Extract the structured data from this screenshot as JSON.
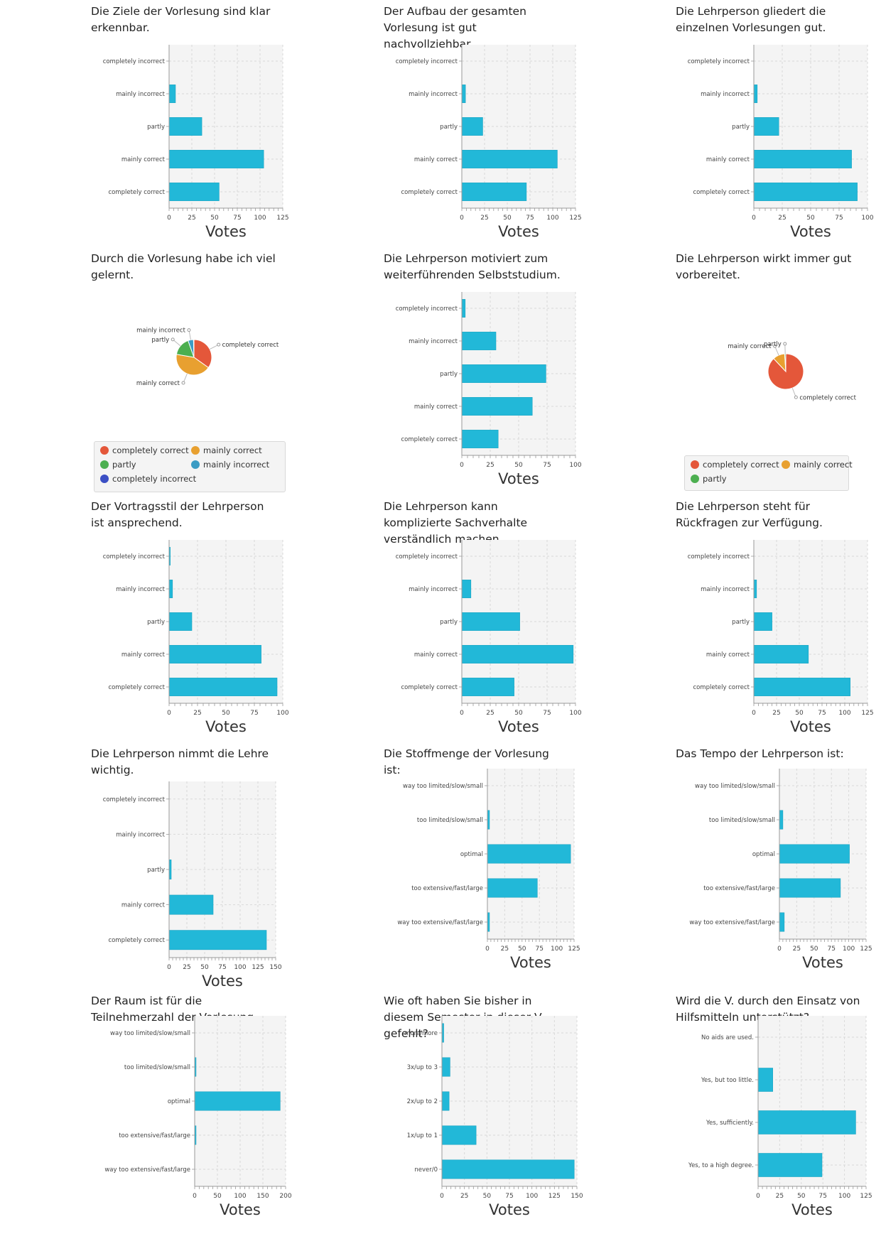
{
  "colors": {
    "bar": "#22b8d8",
    "plot_bg": "#f4f4f4",
    "completely_correct": "#e4573a",
    "mainly_correct": "#e8a030",
    "partly": "#4caf50",
    "mainly_incorrect": "#3b9cc4",
    "completely_incorrect": "#3b4fc4"
  },
  "chart_data": [
    {
      "type": "bar",
      "title": "Die Ziele der Vorlesung sind klar erkennbar.",
      "xlabel": "Votes",
      "categories": [
        "completely incorrect",
        "mainly incorrect",
        "partly",
        "mainly correct",
        "completely correct"
      ],
      "values": [
        0,
        7,
        36,
        104,
        55
      ],
      "xlim": [
        0,
        125
      ],
      "xticks": [
        "0",
        "25",
        "50",
        "75",
        "100",
        "125"
      ]
    },
    {
      "type": "bar",
      "title": "Der Aufbau der gesamten Vorlesung ist gut nachvollziehbar.",
      "xlabel": "Votes",
      "categories": [
        "completely incorrect",
        "mainly incorrect",
        "partly",
        "mainly correct",
        "completely correct"
      ],
      "values": [
        0,
        4,
        23,
        105,
        71
      ],
      "xlim": [
        0,
        125
      ],
      "xticks": [
        "0",
        "25",
        "50",
        "75",
        "100",
        "125"
      ]
    },
    {
      "type": "bar",
      "title": "Die Lehrperson gliedert die einzelnen Vorlesungen gut.",
      "xlabel": "Votes",
      "categories": [
        "completely incorrect",
        "mainly incorrect",
        "partly",
        "mainly correct",
        "completely correct"
      ],
      "values": [
        0,
        3,
        22,
        86,
        91
      ],
      "xlim": [
        0,
        100
      ],
      "xticks": [
        "0",
        "25",
        "50",
        "75",
        "100"
      ]
    },
    {
      "type": "pie",
      "title": "Durch die Vorlesung habe ich viel gelernt.",
      "slices": [
        {
          "label": "completely correct",
          "value": 35,
          "color": "#e4573a"
        },
        {
          "label": "mainly correct",
          "value": 43,
          "color": "#e8a030"
        },
        {
          "label": "partly",
          "value": 17,
          "color": "#4caf50"
        },
        {
          "label": "mainly incorrect",
          "value": 5,
          "color": "#3b9cc4"
        },
        {
          "label": "completely incorrect",
          "value": 0.4,
          "color": "#3b4fc4"
        }
      ],
      "legend": [
        "completely correct",
        "mainly correct",
        "partly",
        "mainly incorrect",
        "completely incorrect"
      ]
    },
    {
      "type": "bar",
      "title": "Die Lehrperson motiviert zum weiterführenden Selbststudium.",
      "xlabel": "Votes",
      "categories": [
        "completely incorrect",
        "mainly incorrect",
        "partly",
        "mainly correct",
        "completely correct"
      ],
      "values": [
        3,
        30,
        74,
        62,
        32
      ],
      "xlim": [
        0,
        100
      ],
      "xticks": [
        "0",
        "25",
        "50",
        "75",
        "100"
      ]
    },
    {
      "type": "pie",
      "title": "Die Lehrperson wirkt immer gut vorbereitet.",
      "slices": [
        {
          "label": "completely correct",
          "value": 88,
          "color": "#e4573a"
        },
        {
          "label": "mainly correct",
          "value": 11,
          "color": "#e8a030"
        },
        {
          "label": "partly",
          "value": 1,
          "color": "#4caf50"
        }
      ],
      "legend": [
        "completely correct",
        "mainly correct",
        "partly"
      ]
    },
    {
      "type": "bar",
      "title": "Der Vortragsstil der Lehrperson ist ansprechend.",
      "xlabel": "Votes",
      "categories": [
        "completely incorrect",
        "mainly incorrect",
        "partly",
        "mainly correct",
        "completely correct"
      ],
      "values": [
        1,
        3,
        20,
        81,
        95
      ],
      "xlim": [
        0,
        100
      ],
      "xticks": [
        "0",
        "25",
        "50",
        "75",
        "100"
      ]
    },
    {
      "type": "bar",
      "title": "Die Lehrperson kann komplizierte Sachverhalte verständlich machen.",
      "xlabel": "Votes",
      "categories": [
        "completely incorrect",
        "mainly incorrect",
        "partly",
        "mainly correct",
        "completely correct"
      ],
      "values": [
        0,
        8,
        51,
        98,
        46
      ],
      "xlim": [
        0,
        100
      ],
      "xticks": [
        "0",
        "25",
        "50",
        "75",
        "100"
      ]
    },
    {
      "type": "bar",
      "title": "Die Lehrperson steht für Rückfragen zur Verfügung.",
      "xlabel": "Votes",
      "categories": [
        "completely incorrect",
        "mainly incorrect",
        "partly",
        "mainly correct",
        "completely correct"
      ],
      "values": [
        0,
        3,
        20,
        60,
        106
      ],
      "xlim": [
        0,
        125
      ],
      "xticks": [
        "0",
        "25",
        "50",
        "75",
        "100",
        "125"
      ]
    },
    {
      "type": "bar",
      "title": "Die Lehrperson nimmt die Lehre wichtig.",
      "xlabel": "Votes",
      "categories": [
        "completely incorrect",
        "mainly incorrect",
        "partly",
        "mainly correct",
        "completely correct"
      ],
      "values": [
        0,
        0,
        3,
        62,
        137
      ],
      "xlim": [
        0,
        150
      ],
      "xticks": [
        "0",
        "25",
        "50",
        "75",
        "100",
        "125",
        "150"
      ]
    },
    {
      "type": "bar",
      "title": "Die Stoffmenge der Vorlesung ist:",
      "xlabel": "Votes",
      "categories": [
        "way too limited/slow/small",
        "too limited/slow/small",
        "optimal",
        "too extensive/fast/large",
        "way too extensive/fast/large"
      ],
      "values": [
        0,
        3,
        120,
        72,
        3
      ],
      "xlim": [
        0,
        125
      ],
      "xticks": [
        "0",
        "25",
        "50",
        "75",
        "100",
        "125"
      ]
    },
    {
      "type": "bar",
      "title": "Das Tempo der Lehrperson ist:",
      "xlabel": "Votes",
      "categories": [
        "way too limited/slow/small",
        "too limited/slow/small",
        "optimal",
        "too extensive/fast/large",
        "way too extensive/fast/large"
      ],
      "values": [
        0,
        5,
        101,
        88,
        7
      ],
      "xlim": [
        0,
        125
      ],
      "xticks": [
        "0",
        "25",
        "50",
        "75",
        "100",
        "125"
      ]
    },
    {
      "type": "bar",
      "title": "Der Raum ist für die Teilnehmerzahl der Vorlesung",
      "xlabel": "Votes",
      "categories": [
        "way too limited/slow/small",
        "too limited/slow/small",
        "optimal",
        "too extensive/fast/large",
        "way too extensive/fast/large"
      ],
      "values": [
        0,
        3,
        188,
        3,
        0
      ],
      "xlim": [
        0,
        200
      ],
      "xticks": [
        "0",
        "50",
        "100",
        "150",
        "200"
      ]
    },
    {
      "type": "bar",
      "title": "Wie oft haben Sie bisher in diesem Semester in dieser V. gefehlt?",
      "xlabel": "Votes",
      "categories": [
        "more/more",
        "3x/up to 3",
        "2x/up to 2",
        "1x/up to 1",
        "never/0"
      ],
      "values": [
        2,
        9,
        8,
        38,
        147
      ],
      "xlim": [
        0,
        150
      ],
      "xticks": [
        "0",
        "25",
        "50",
        "75",
        "100",
        "125",
        "150"
      ]
    },
    {
      "type": "bar",
      "title": "Wird die V. durch den Einsatz von Hilfsmitteln unterstützt?",
      "xlabel": "Votes",
      "categories": [
        "No aids are used.",
        "Yes, but too little.",
        "Yes, sufficiently.",
        "Yes, to a high degree."
      ],
      "values": [
        0,
        17,
        113,
        74
      ],
      "xlim": [
        0,
        125
      ],
      "xticks": [
        "0",
        "25",
        "50",
        "75",
        "100",
        "125"
      ]
    }
  ]
}
